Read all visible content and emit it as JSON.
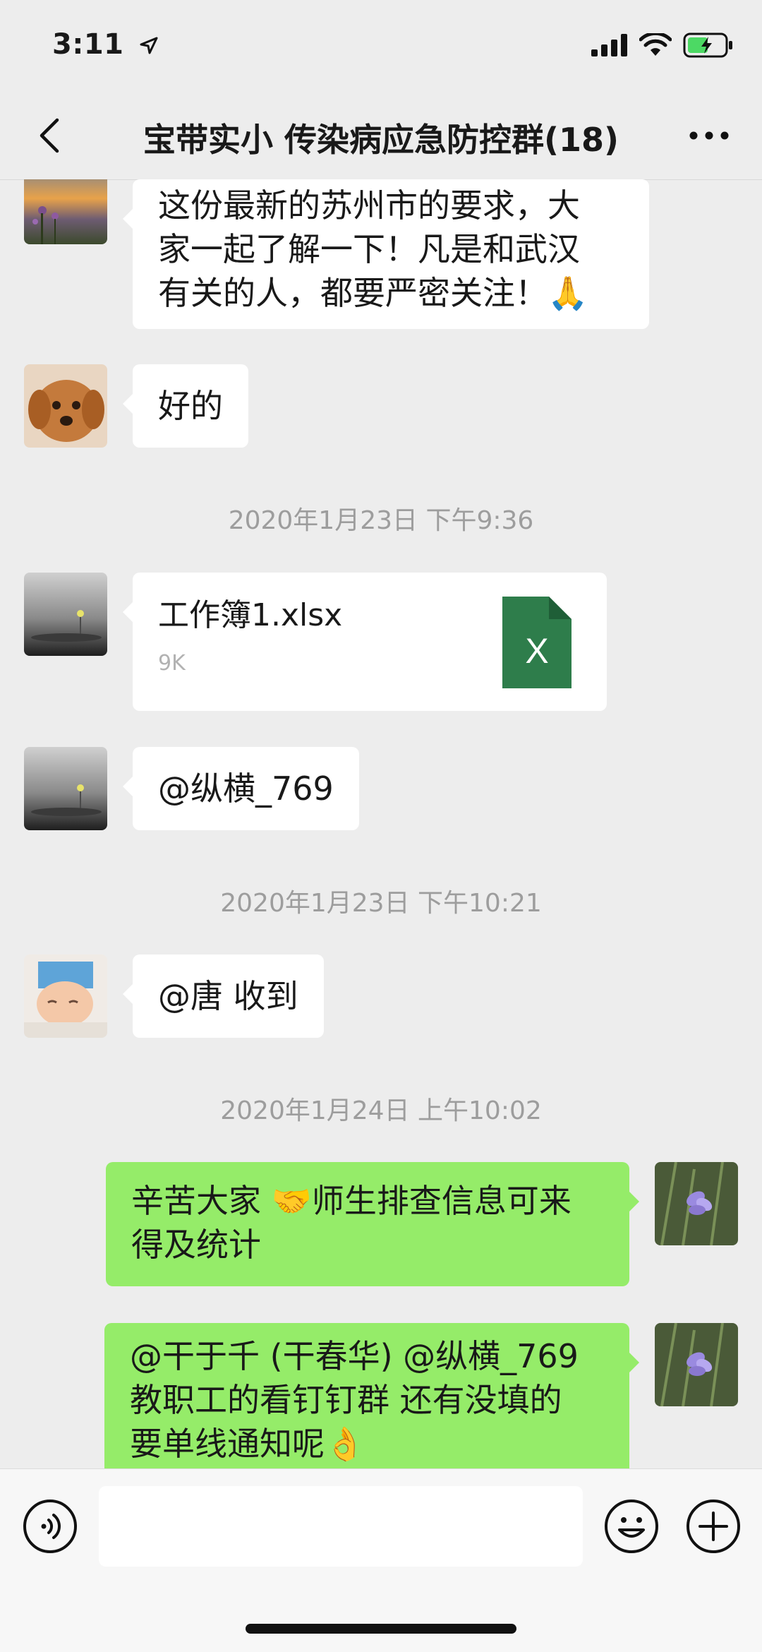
{
  "status_bar": {
    "time": "3:11"
  },
  "header": {
    "title": "宝带实小 传染病应急防控群(18)"
  },
  "messages": {
    "m1": {
      "line1": "这份最新的苏州市的要求，大",
      "line2": "家一起了解一下！凡是和武汉",
      "line3": "有关的人，都要严密关注！🙏"
    },
    "m2": {
      "text": "好的"
    },
    "ts1": "2020年1月23日 下午9:36",
    "file": {
      "name": "工作簿1.xlsx",
      "size": "9K",
      "icon_letter": "X"
    },
    "m4": {
      "text": "@纵横_769"
    },
    "ts2": "2020年1月23日 下午10:21",
    "m5": {
      "text": "@唐 收到"
    },
    "ts3": "2020年1月24日 上午10:02",
    "m6": {
      "line1": "辛苦大家 🤝师生排查信息可来",
      "line2": "得及统计"
    },
    "m7": {
      "line1": "@干于千 (干春华) @纵横_769",
      "line2": "教职工的看钉钉群 还有没填的",
      "line3": "要单线通知呢👌"
    }
  },
  "input_bar": {
    "placeholder": ""
  },
  "colors": {
    "background": "#ededed",
    "incoming_bubble": "#ffffff",
    "outgoing_bubble": "#95ec69",
    "excel_green": "#2e7d4b"
  },
  "icons": [
    "back-arrow-icon",
    "more-dots-icon",
    "voice-icon",
    "emoji-icon",
    "add-icon",
    "excel-file-icon",
    "signal-icon",
    "wifi-icon",
    "battery-icon",
    "location-arrow-icon"
  ]
}
